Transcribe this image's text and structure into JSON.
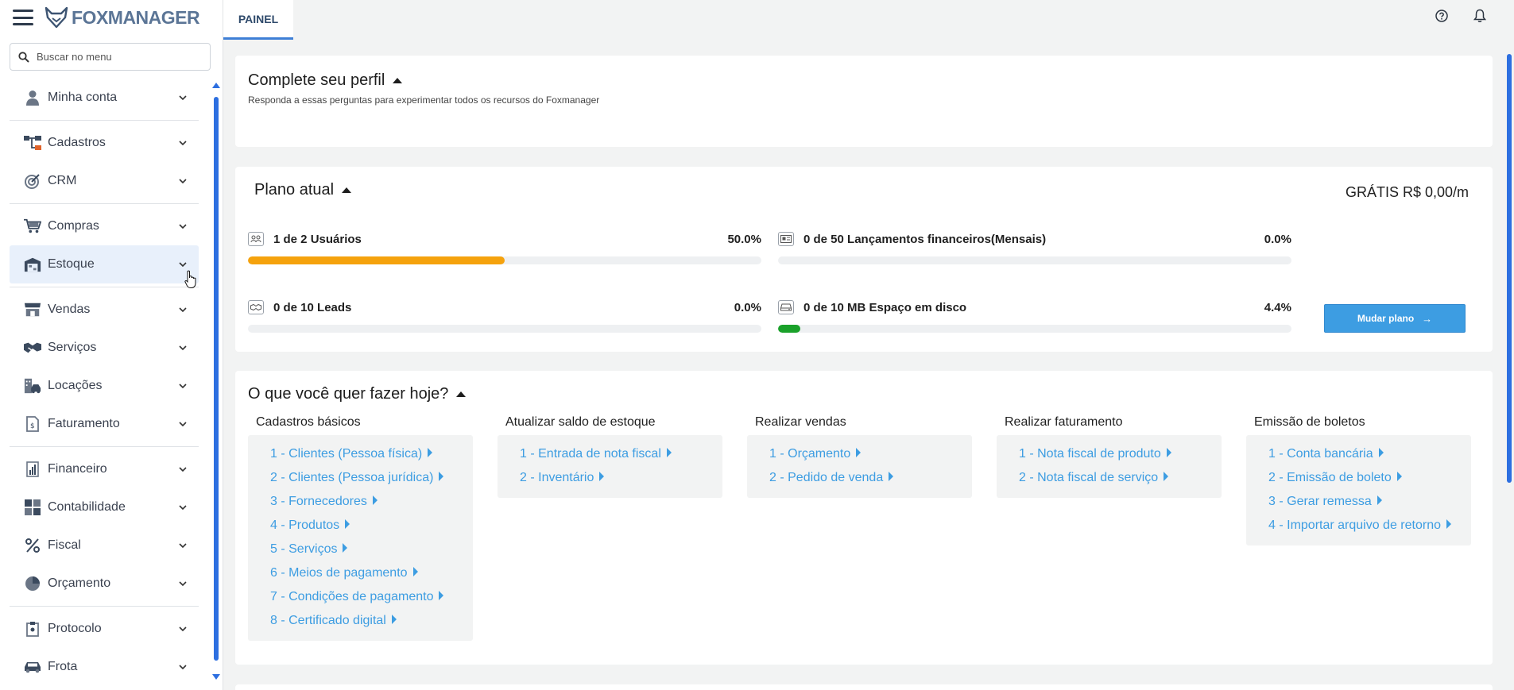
{
  "app": {
    "logo_text": "FOXMANAGER"
  },
  "search": {
    "placeholder": "Buscar no menu"
  },
  "sidebar": {
    "items": [
      {
        "label": "Minha conta",
        "icon": "user-icon"
      },
      {
        "label": "Cadastros",
        "icon": "sitemap-icon"
      },
      {
        "label": "CRM",
        "icon": "target-icon"
      },
      {
        "label": "Compras",
        "icon": "cart-icon"
      },
      {
        "label": "Estoque",
        "icon": "warehouse-icon"
      },
      {
        "label": "Vendas",
        "icon": "store-icon"
      },
      {
        "label": "Serviços",
        "icon": "handshake-icon"
      },
      {
        "label": "Locações",
        "icon": "building-car-icon"
      },
      {
        "label": "Faturamento",
        "icon": "invoice-icon"
      },
      {
        "label": "Financeiro",
        "icon": "chart-bar-icon"
      },
      {
        "label": "Contabilidade",
        "icon": "calculator-icon"
      },
      {
        "label": "Fiscal",
        "icon": "percent-icon"
      },
      {
        "label": "Orçamento",
        "icon": "pie-chart-icon"
      },
      {
        "label": "Protocolo",
        "icon": "clipboard-icon"
      },
      {
        "label": "Frota",
        "icon": "car-icon"
      }
    ]
  },
  "topbar": {
    "tab": "PAINEL"
  },
  "profile": {
    "title": "Complete seu perfil",
    "subtitle": "Responda a essas perguntas para experimentar todos os recursos do Foxmanager"
  },
  "plan": {
    "title": "Plano atual",
    "price": "GRÁTIS R$ 0,00/m",
    "button": "Mudar plano",
    "usage": [
      {
        "label": "1 de 2 Usuários",
        "pct": "50.0%",
        "fraction": 0.5,
        "color": "#f5a20d",
        "icon": "users-icon"
      },
      {
        "label": "0 de 50 Lançamentos financeiros(Mensais)",
        "pct": "0.0%",
        "fraction": 0.0,
        "color": "#f5a20d",
        "icon": "id-card-icon"
      },
      {
        "label": "0 de 10 Leads",
        "pct": "0.0%",
        "fraction": 0.0,
        "color": "#f5a20d",
        "icon": "handshake-icon"
      },
      {
        "label": "0 de 10 MB Espaço em disco",
        "pct": "4.4%",
        "fraction": 0.044,
        "color": "#1aa12a",
        "icon": "disk-icon"
      }
    ]
  },
  "todo": {
    "title": "O que você quer fazer hoje?",
    "columns": [
      {
        "title": "Cadastros básicos",
        "links": [
          "1 - Clientes (Pessoa física)",
          "2 - Clientes (Pessoa jurídica)",
          "3 - Fornecedores",
          "4 - Produtos",
          "5 - Serviços",
          "6 - Meios de pagamento",
          "7 - Condições de pagamento",
          "8 - Certificado digital"
        ]
      },
      {
        "title": "Atualizar saldo de estoque",
        "links": [
          "1 - Entrada de nota fiscal",
          "2 - Inventário"
        ]
      },
      {
        "title": "Realizar vendas",
        "links": [
          "1 - Orçamento",
          "2 - Pedido de venda"
        ]
      },
      {
        "title": "Realizar faturamento",
        "links": [
          "1 - Nota fiscal de produto",
          "2 - Nota fiscal de serviço"
        ]
      },
      {
        "title": "Emissão de boletos",
        "links": [
          "1 - Conta bancária",
          "2 - Emissão de boleto",
          "3 - Gerar remessa",
          "4 - Importar arquivo de retorno"
        ]
      }
    ]
  },
  "colors": {
    "accent": "#3d9de2",
    "tab_underline": "#3e7fd6",
    "active_item_bg": "#e8f0fb",
    "users_bar": "#f5a20d",
    "disk_bar": "#1aa12a"
  }
}
